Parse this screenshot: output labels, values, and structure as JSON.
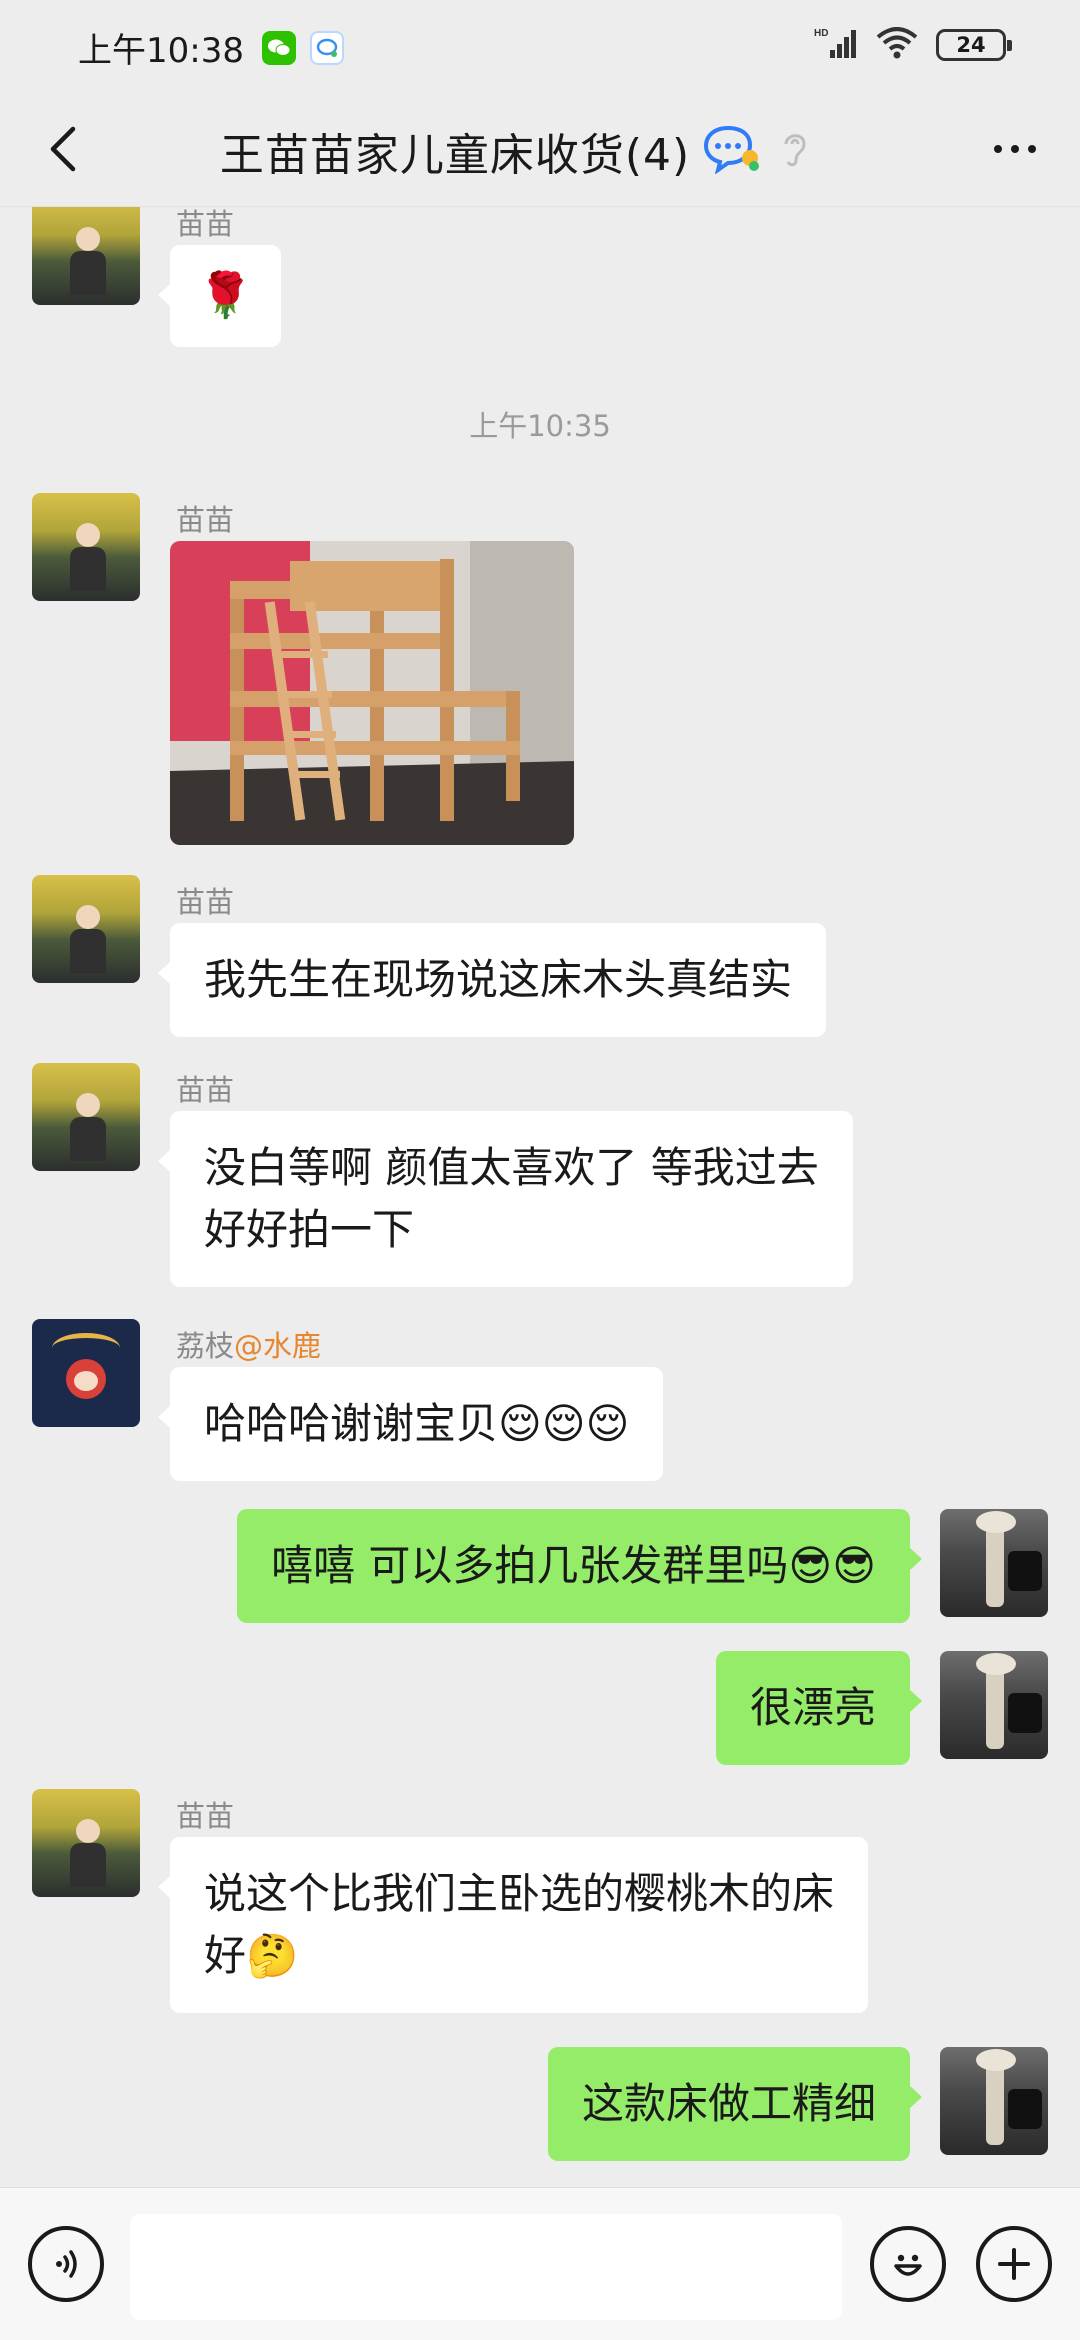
{
  "status_bar": {
    "time": "上午10:38",
    "network": "HD",
    "battery": "24"
  },
  "header": {
    "title": "王苗苗家儿童床收货(4)"
  },
  "messages": [
    {
      "sender": "苗苗",
      "side": "left",
      "content": "🌹"
    },
    {
      "timestamp": "上午10:35"
    },
    {
      "sender": "苗苗",
      "side": "left",
      "type": "image"
    },
    {
      "sender": "苗苗",
      "side": "left",
      "content": "我先生在现场说这床木头真结实"
    },
    {
      "sender": "苗苗",
      "side": "left",
      "content_lines": [
        "没白等啊 颜值太喜欢了 等我过去",
        "好好拍一下"
      ]
    },
    {
      "sender": "荔枝",
      "mention": "@水鹿",
      "side": "left",
      "content": "哈哈哈谢谢宝贝😌😌😌"
    },
    {
      "side": "right",
      "content": "嘻嘻 可以多拍几张发群里吗😎😎"
    },
    {
      "side": "right",
      "content": "很漂亮"
    },
    {
      "sender": "苗苗",
      "side": "left",
      "content_lines": [
        "说这个比我们主卧选的樱桃木的床",
        "好🤔"
      ]
    },
    {
      "side": "right",
      "content": "这款床做工精细"
    }
  ],
  "colors": {
    "background": "#ededed",
    "bubble_self": "#95ec69",
    "bubble_other": "#ffffff",
    "mention": "#e8862f"
  }
}
